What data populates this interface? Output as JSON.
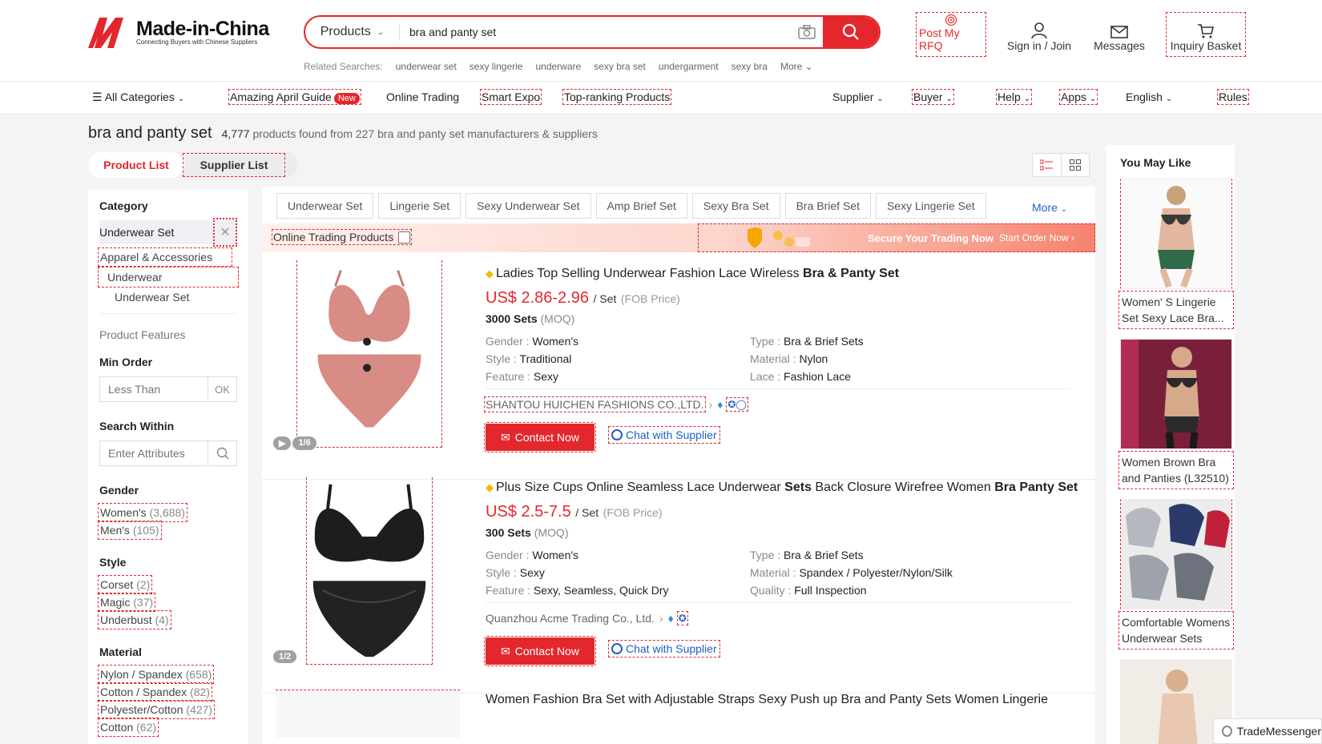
{
  "header": {
    "logo_text": "Made-in-China",
    "logo_subtext": "Connecting Buyers with Chinese Suppliers",
    "search_category": "Products",
    "search_value": "bra and panty set",
    "related_label": "Related Searches:",
    "related": [
      "underwear set",
      "sexy lingerie",
      "underware",
      "sexy bra set",
      "undergarment",
      "sexy bra",
      "More"
    ],
    "post_rfq": "Post My RFQ",
    "sign_in": "Sign in / Join",
    "messages": "Messages",
    "inquiry_basket": "Inquiry Basket"
  },
  "nav": {
    "all_categories": "All Categories",
    "amazing_april": "Amazing April Guide",
    "new_badge": "New",
    "online_trading": "Online Trading",
    "smart_expo": "Smart Expo",
    "top_ranking": "Top-ranking Products",
    "supplier": "Supplier",
    "buyer": "Buyer",
    "help": "Help",
    "apps": "Apps",
    "language": "English",
    "rules": "Rules"
  },
  "results": {
    "title": "bra and panty set",
    "count": "4,777",
    "found_text": "products found from 227  bra and panty set manufacturers & suppliers",
    "tab_product": "Product List",
    "tab_supplier": "Supplier List"
  },
  "sidebar": {
    "category_heading": "Category",
    "selected_category": "Underwear Set",
    "cat_level1": "Apparel & Accessories",
    "cat_level2": "Underwear",
    "cat_level3": "Underwear Set",
    "product_features": "Product Features",
    "min_order_heading": "Min Order",
    "min_order_placeholder": "Less Than",
    "min_order_ok": "OK",
    "search_within_heading": "Search Within",
    "search_within_placeholder": "Enter Attributes",
    "gender_heading": "Gender",
    "gender": [
      {
        "label": "Women's",
        "count": "(3,688)"
      },
      {
        "label": "Men's",
        "count": "(105)"
      }
    ],
    "style_heading": "Style",
    "style": [
      {
        "label": "Corset",
        "count": "(2)"
      },
      {
        "label": "Magic",
        "count": "(37)"
      },
      {
        "label": "Underbust",
        "count": "(4)"
      }
    ],
    "material_heading": "Material",
    "material": [
      {
        "label": "Nylon / Spandex",
        "count": "(658)"
      },
      {
        "label": "Cotton / Spandex",
        "count": "(82)"
      },
      {
        "label": "Polyester/Cotton",
        "count": "(427)"
      },
      {
        "label": "Cotton",
        "count": "(62)"
      }
    ]
  },
  "chips": [
    "Underwear Set",
    "Lingerie Set",
    "Sexy Underwear Set",
    "Amp Brief Set",
    "Sexy Bra Set",
    "Bra Brief Set",
    "Sexy Lingerie Set"
  ],
  "chips_more": "More",
  "banner": {
    "online_trading_products": "Online Trading Products",
    "secure_text": "Secure Your Trading Now",
    "start_order": "Start Order Now  ›"
  },
  "products": [
    {
      "title_pre": "Ladies Top Selling Underwear Fashion Lace Wireless ",
      "title_bold": "Bra & Panty Set",
      "title_post": "",
      "price": "US$ 2.86-2.96",
      "unit": "/ Set",
      "fob": "(FOB Price)",
      "moq": "3000 Sets",
      "moq_label": "(MOQ)",
      "attrs": [
        {
          "k": "Gender",
          "v": "Women's"
        },
        {
          "k": "Type",
          "v": "Bra & Brief Sets"
        },
        {
          "k": "Style",
          "v": "Traditional"
        },
        {
          "k": "Material",
          "v": "Nylon"
        },
        {
          "k": "Feature",
          "v": "Sexy"
        },
        {
          "k": "Lace",
          "v": "Fashion Lace"
        }
      ],
      "supplier": "SHANTOU HUICHEN FASHIONS CO.,LTD.",
      "image_count": "1/6",
      "contact": "Contact Now",
      "chat": "Chat with Supplier",
      "color": "#d98b86"
    },
    {
      "title_pre": "Plus Size Cups Online Seamless Lace Underwear ",
      "title_bold": "Sets",
      "title_post": " Back Closure Wirefree Women ",
      "title_bold2": "Bra Panty Set",
      "price": "US$ 2.5-7.5",
      "unit": "/ Set",
      "fob": "(FOB Price)",
      "moq": "300 Sets",
      "moq_label": "(MOQ)",
      "attrs": [
        {
          "k": "Gender",
          "v": "Women's"
        },
        {
          "k": "Type",
          "v": "Bra & Brief Sets"
        },
        {
          "k": "Style",
          "v": "Sexy"
        },
        {
          "k": "Material",
          "v": "Spandex / Polyester/Nylon/Silk"
        },
        {
          "k": "Feature",
          "v": "Sexy, Seamless, Quick Dry"
        },
        {
          "k": "Quality",
          "v": "Full Inspection"
        }
      ],
      "supplier": "Quanzhou Acme Trading Co., Ltd.",
      "image_count": "1/2",
      "contact": "Contact Now",
      "chat": "Chat with Supplier",
      "color": "#1d1d1d"
    }
  ],
  "product3_title": "Women Fashion Bra Set with Adjustable Straps Sexy Push up Bra and Panty Sets Women Lingerie",
  "rail": {
    "title": "You May Like",
    "items": [
      {
        "caption": "Women' S Lingerie Set Sexy Lace Bra..."
      },
      {
        "caption": "Women Brown Bra and Panties (L32510)"
      },
      {
        "caption": "Comfortable Womens Underwear Sets Soli..."
      }
    ]
  },
  "trademessenger": "TradeMessenger",
  "colors": {
    "accent": "#e3272d",
    "link": "#1f5fc4"
  }
}
